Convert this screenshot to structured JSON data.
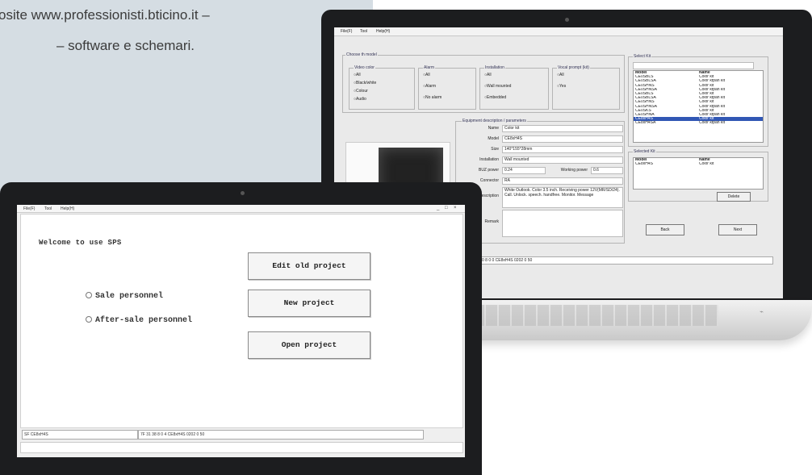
{
  "intro": {
    "line1": "osite  www.professionisti.bticino.it  –",
    "line2": "– software e schemari."
  },
  "back_app": {
    "menu": [
      "File(F)",
      "Tool",
      "Help(H)"
    ],
    "choose_title": "Choose th model",
    "filter_groups": [
      {
        "title": "Video color",
        "options": [
          "All",
          "Black/white",
          "Colour",
          "Audio"
        ]
      },
      {
        "title": "Alarm",
        "options": [
          "All",
          "Alarm",
          "No alarm"
        ]
      },
      {
        "title": "Installation",
        "options": [
          "All",
          "Wall mounted",
          "Embedded"
        ]
      },
      {
        "title": "Vocal prompt (kit)",
        "options": [
          "All",
          "Yes"
        ]
      }
    ],
    "details_title": "Equipment description / parameters",
    "fields": [
      {
        "label": "Name",
        "value": "Color kit"
      },
      {
        "label": "Model",
        "value": "CE8xH4S"
      },
      {
        "label": "Size",
        "value": "140*155*28mm"
      },
      {
        "label": "Installation",
        "value": "Wall mounted"
      },
      {
        "label": "BUZ power",
        "value": "0.24"
      },
      {
        "label": "Working power",
        "value": "0.6"
      },
      {
        "label": "Connector",
        "value": "RA"
      },
      {
        "label": "Description",
        "value": "White Outlook. Color 3.5 inch. Receiving power 12V(MR/SD/24). Call. Unlock. speech. handfree. Monitor. Message"
      },
      {
        "label": "Remark",
        "value": ""
      }
    ],
    "select_title": "Select Kit",
    "model_search": "",
    "list_headers": [
      "Model",
      "Name"
    ],
    "list_rows": [
      [
        "CE0SBLS",
        "Color kit"
      ],
      [
        "CE0SBLSA",
        "Color ktpan kit"
      ],
      [
        "CE0SHNS",
        "Color kit"
      ],
      [
        "CE0SHNSA",
        "Color ktpan kit"
      ],
      [
        "CE0SBLS",
        "Color kit"
      ],
      [
        "CE0SBLSA",
        "Color ktpan kit"
      ],
      [
        "CE0SHNS",
        "Color kit"
      ],
      [
        "CE0SHNSA",
        "Color ktpan kit"
      ],
      [
        "CE0SKS",
        "Color kit"
      ],
      [
        "CE0SHNA",
        "Color ktpan kit"
      ],
      [
        "CE8xH4S",
        "Color kit"
      ],
      [
        "CE8xH4SA",
        "Color ktpan kit"
      ]
    ],
    "selected_row_index": 10,
    "selected_title": "Selected Kit",
    "selected_headers": [
      "Model",
      "Name"
    ],
    "selected_rows": [
      [
        "CE8xH4S",
        "Color kit"
      ]
    ],
    "delete_label": "Delete",
    "back_label": "Back",
    "next_label": "Next",
    "status": "7F 30 8 0 0 CE8xH4S 0202 0 50"
  },
  "front_app": {
    "menu": [
      "File(F)",
      "Tool",
      "Help(H)"
    ],
    "window_controls": [
      "_",
      "□",
      "×"
    ],
    "welcome": "Welcome to use SPS",
    "buttons": {
      "edit": "Edit old project",
      "new": "New project",
      "open": "Open project"
    },
    "radios": {
      "sale": "Sale personnel",
      "after": "After-sale personnel"
    },
    "status_left": "SF CE8xH4S",
    "status_right": "7F 31 38 8 0 4 CE8xH4S 0202 0 50"
  },
  "colors": {
    "background_panel": "#d5dde3",
    "laptop_bezel": "#1c1d1f",
    "selection": "#3157b4"
  }
}
